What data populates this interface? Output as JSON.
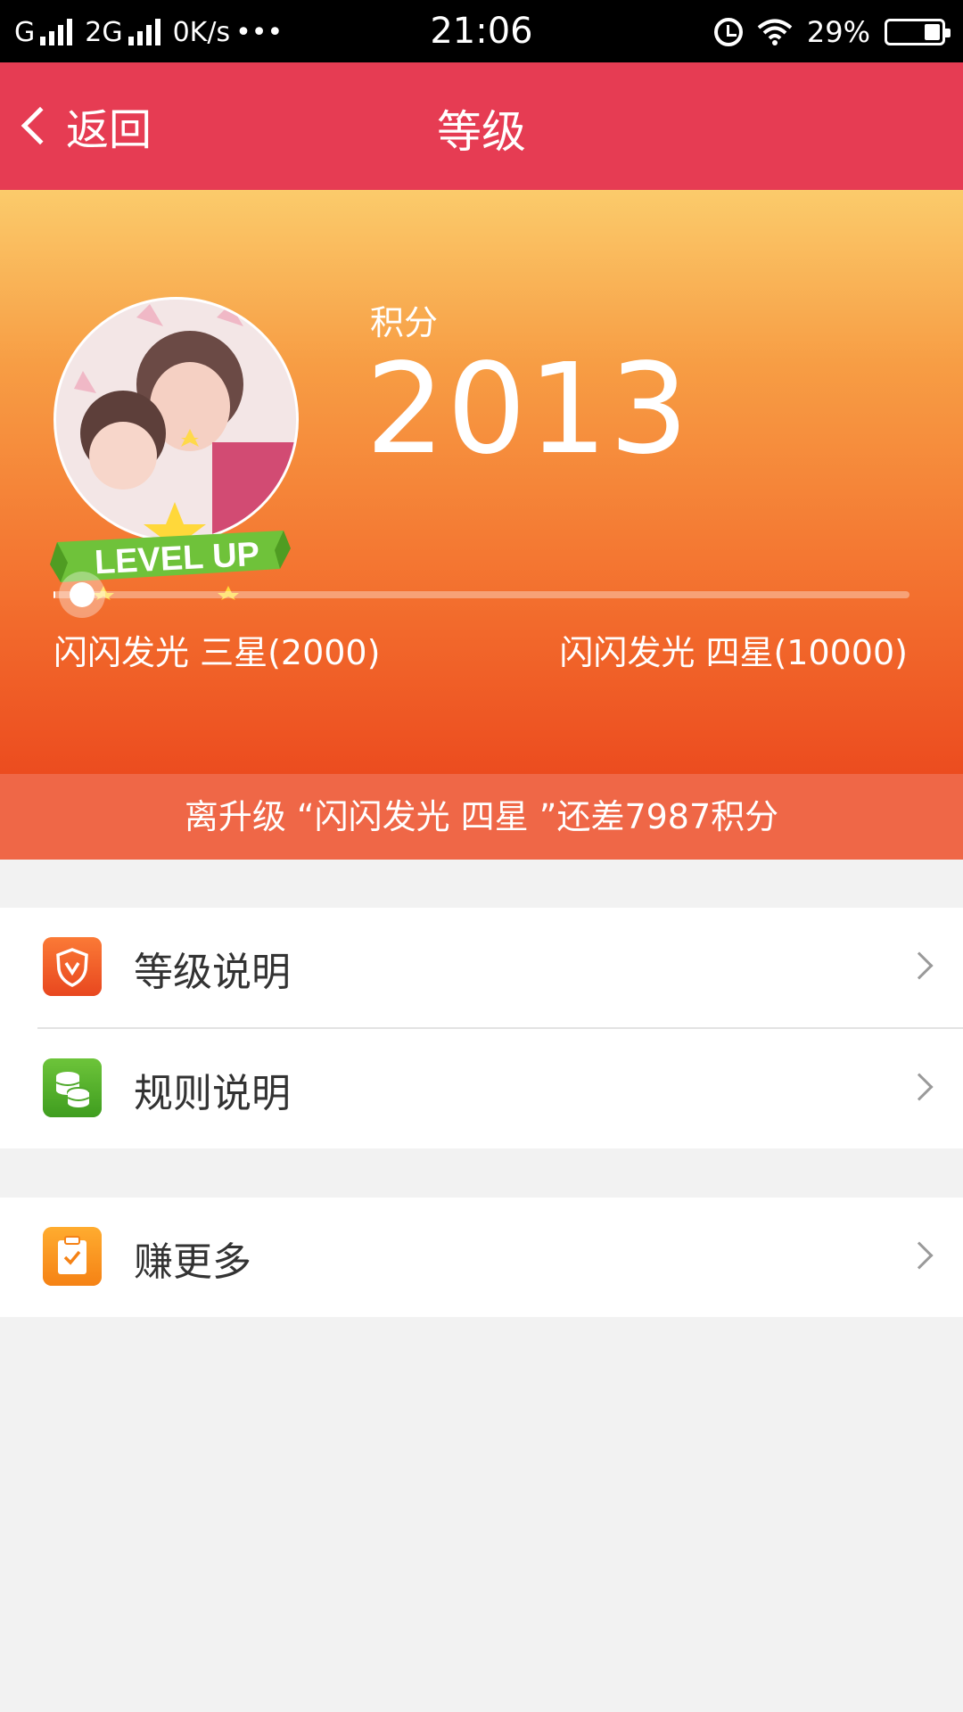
{
  "status_bar": {
    "network_1": "G",
    "network_2": "2G",
    "speed": "0K/s",
    "more": "•••",
    "time": "21:06",
    "battery": "29%"
  },
  "header": {
    "back_label": "返回",
    "title": "等级"
  },
  "hero": {
    "avatar_badge_text": "LEVEL UP",
    "score_label": "积分",
    "score_value": "2013",
    "current_level": "闪闪发光 三星(2000)",
    "next_level": "闪闪发光 四星(10000)",
    "progress_fraction": 0.0016,
    "notice": "离升级 “闪闪发光 四星 ”还差7987积分"
  },
  "menu": {
    "items": [
      {
        "label": "等级说明",
        "icon": "shield-icon"
      },
      {
        "label": "规则说明",
        "icon": "coins-icon"
      },
      {
        "label": "赚更多",
        "icon": "clipboard-check-icon"
      }
    ]
  },
  "colors": {
    "header": "#e63c53",
    "hero_top": "#fbcb6b",
    "hero_bottom": "#ec4c1f",
    "notice": "#ef6747",
    "background": "#f2f2f2"
  }
}
